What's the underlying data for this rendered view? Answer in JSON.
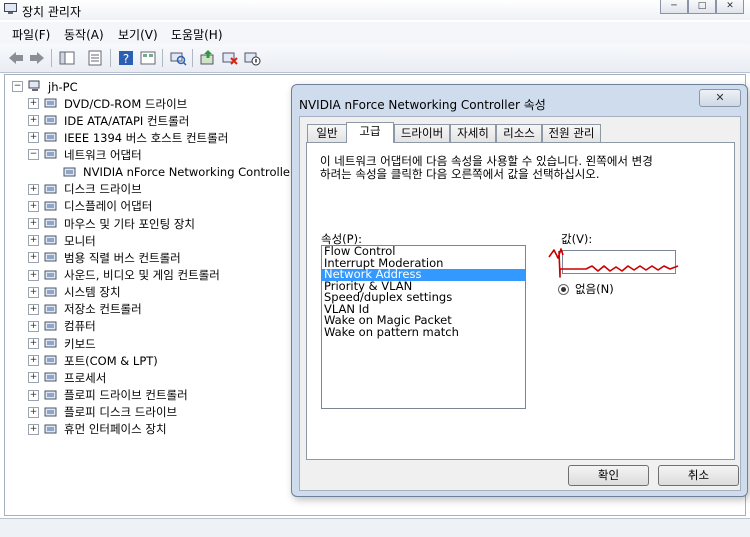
{
  "window": {
    "title": "장치 관리자",
    "minimize": "─",
    "maximize": "□",
    "close": "✕"
  },
  "menu": [
    "파일(F)",
    "동작(A)",
    "보기(V)",
    "도움말(H)"
  ],
  "tree": {
    "root": "jh-PC",
    "items": [
      {
        "label": "DVD/CD-ROM 드라이브",
        "icon": "dvd-drive-icon"
      },
      {
        "label": "IDE ATA/ATAPI 컨트롤러",
        "icon": "ide-controller-icon"
      },
      {
        "label": "IEEE 1394 버스 호스트 컨트롤러",
        "icon": "firewire-icon"
      },
      {
        "label": "네트워크 어댑터",
        "icon": "network-adapter-icon",
        "expanded": true
      },
      {
        "label": "NVIDIA nForce Networking Controller",
        "icon": "network-card-icon",
        "child": true
      },
      {
        "label": "디스크 드라이브",
        "icon": "disk-drive-icon"
      },
      {
        "label": "디스플레이 어댑터",
        "icon": "display-adapter-icon"
      },
      {
        "label": "마우스 및 기타 포인팅 장치",
        "icon": "mouse-icon"
      },
      {
        "label": "모니터",
        "icon": "monitor-icon"
      },
      {
        "label": "범용 직렬 버스 컨트롤러",
        "icon": "usb-icon"
      },
      {
        "label": "사운드, 비디오 및 게임 컨트롤러",
        "icon": "sound-icon"
      },
      {
        "label": "시스템 장치",
        "icon": "system-device-icon"
      },
      {
        "label": "저장소 컨트롤러",
        "icon": "storage-controller-icon"
      },
      {
        "label": "컴퓨터",
        "icon": "computer-icon"
      },
      {
        "label": "키보드",
        "icon": "keyboard-icon"
      },
      {
        "label": "포트(COM & LPT)",
        "icon": "port-icon"
      },
      {
        "label": "프로세서",
        "icon": "processor-icon"
      },
      {
        "label": "플로피 드라이브 컨트롤러",
        "icon": "floppy-controller-icon"
      },
      {
        "label": "플로피 디스크 드라이브",
        "icon": "floppy-drive-icon"
      },
      {
        "label": "휴먼 인터페이스 장치",
        "icon": "hid-icon"
      }
    ]
  },
  "dialog": {
    "title": "NVIDIA nForce Networking Controller 속성",
    "close": "✕",
    "tabs": [
      "일반",
      "고급",
      "드라이버",
      "자세히",
      "리소스",
      "전원 관리"
    ],
    "active_tab": "고급",
    "description_line1": "이 네트워크 어댑터에 다음 속성을 사용할 수 있습니다. 왼쪽에서 변경",
    "description_line2": "하려는 속성을 클릭한 다음 오른쪽에서 값을 선택하십시오.",
    "property_label": "속성(P):",
    "value_label": "값(V):",
    "properties": [
      "Flow Control",
      "Interrupt Moderation",
      "Network Address",
      "Priority & VLAN",
      "Speed/duplex settings",
      "VLAN Id",
      "Wake on Magic Packet",
      "Wake on pattern match"
    ],
    "selected_property": "Network Address",
    "radio_none": "없음(N)",
    "ok": "확인",
    "cancel": "취소",
    "annotation_color": "#cc0000"
  }
}
